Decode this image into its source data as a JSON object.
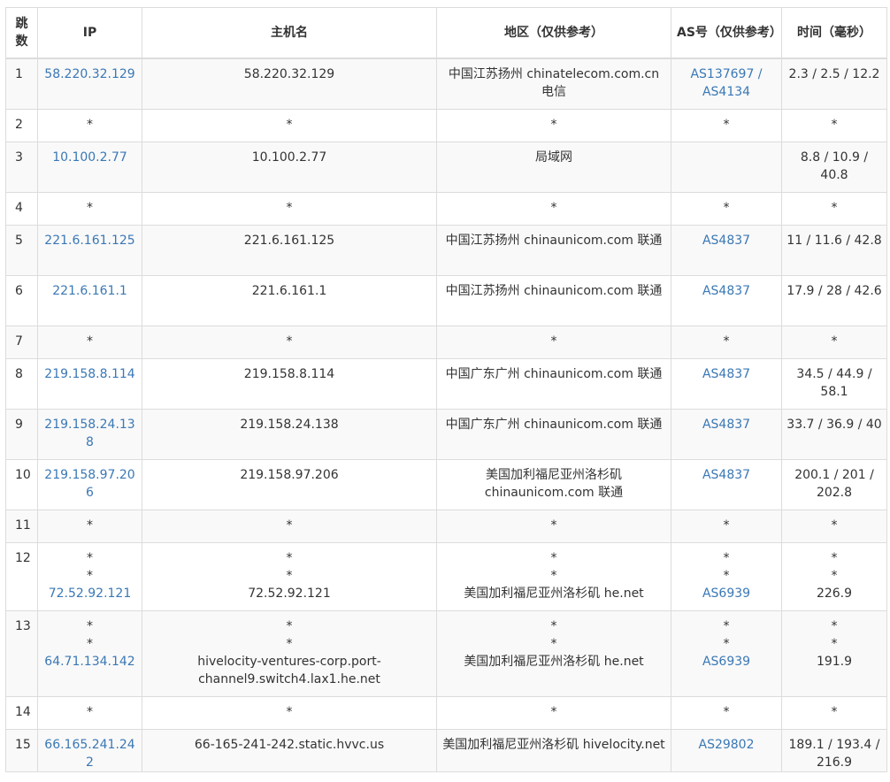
{
  "headers": [
    "跳数",
    "IP",
    "主机名",
    "地区（仅供参考）",
    "AS号（仅供参考）",
    "时间（毫秒）"
  ],
  "rows": [
    {
      "hop": "1",
      "ip": [
        "58.220.32.129"
      ],
      "host": [
        "58.220.32.129"
      ],
      "region": [
        "中国江苏扬州 chinatelecom.com.cn 电信"
      ],
      "as": [
        "AS137697 / AS4134"
      ],
      "time": [
        "2.3 / 2.5 / 12.2"
      ],
      "h": 57
    },
    {
      "hop": "2",
      "ip": [
        "*"
      ],
      "host": [
        "*"
      ],
      "region": [
        "*"
      ],
      "as": [
        "*"
      ],
      "time": [
        "*"
      ],
      "h": 37
    },
    {
      "hop": "3",
      "ip": [
        "10.100.2.77"
      ],
      "host": [
        "10.100.2.77"
      ],
      "region": [
        "局域网"
      ],
      "as": [
        ""
      ],
      "time": [
        "8.8 / 10.9 / 40.8"
      ],
      "h": 57
    },
    {
      "hop": "4",
      "ip": [
        "*"
      ],
      "host": [
        "*"
      ],
      "region": [
        "*"
      ],
      "as": [
        "*"
      ],
      "time": [
        "*"
      ],
      "h": 37
    },
    {
      "hop": "5",
      "ip": [
        "221.6.161.125"
      ],
      "host": [
        "221.6.161.125"
      ],
      "region": [
        "中国江苏扬州 chinaunicom.com 联通"
      ],
      "as": [
        "AS4837"
      ],
      "time": [
        "11 / 11.6 / 42.8"
      ],
      "h": 57
    },
    {
      "hop": "6",
      "ip": [
        "221.6.161.1"
      ],
      "host": [
        "221.6.161.1"
      ],
      "region": [
        "中国江苏扬州 chinaunicom.com 联通"
      ],
      "as": [
        "AS4837"
      ],
      "time": [
        "17.9 / 28 / 42.6"
      ],
      "h": 57
    },
    {
      "hop": "7",
      "ip": [
        "*"
      ],
      "host": [
        "*"
      ],
      "region": [
        "*"
      ],
      "as": [
        "*"
      ],
      "time": [
        "*"
      ],
      "h": 37
    },
    {
      "hop": "8",
      "ip": [
        "219.158.8.114"
      ],
      "host": [
        "219.158.8.114"
      ],
      "region": [
        "中国广东广州 chinaunicom.com 联通"
      ],
      "as": [
        "AS4837"
      ],
      "time": [
        "34.5 / 44.9 / 58.1"
      ],
      "h": 57
    },
    {
      "hop": "9",
      "ip": [
        "219.158.24.138"
      ],
      "host": [
        "219.158.24.138"
      ],
      "region": [
        "中国广东广州 chinaunicom.com 联通"
      ],
      "as": [
        "AS4837"
      ],
      "time": [
        "33.7 / 36.9 / 40"
      ],
      "h": 57
    },
    {
      "hop": "10",
      "ip": [
        "219.158.97.206"
      ],
      "host": [
        "219.158.97.206"
      ],
      "region": [
        "美国加利福尼亚州洛杉矶 chinaunicom.com 联通"
      ],
      "as": [
        "AS4837"
      ],
      "time": [
        "200.1 / 201 / 202.8"
      ],
      "h": 57
    },
    {
      "hop": "11",
      "ip": [
        "*"
      ],
      "host": [
        "*"
      ],
      "region": [
        "*"
      ],
      "as": [
        "*"
      ],
      "time": [
        "*"
      ],
      "h": 37
    },
    {
      "hop": "12",
      "ip": [
        "*",
        "*",
        "72.52.92.121"
      ],
      "host": [
        "*",
        "*",
        "72.52.92.121"
      ],
      "region": [
        "*",
        "*",
        "美国加利福尼亚州洛杉矶 he.net"
      ],
      "as": [
        "*",
        "*",
        "AS6939"
      ],
      "time": [
        "*",
        "*",
        "226.9"
      ],
      "h": 77
    },
    {
      "hop": "13",
      "ip": [
        "*",
        "*",
        "64.71.134.142"
      ],
      "host": [
        "*",
        "*",
        "hivelocity-ventures-corp.port-channel9.switch4.lax1.he.net"
      ],
      "region": [
        "*",
        "*",
        "美国加利福尼亚州洛杉矶 he.net"
      ],
      "as": [
        "*",
        "*",
        "AS6939"
      ],
      "time": [
        "*",
        "*",
        "191.9"
      ],
      "h": 97
    },
    {
      "hop": "14",
      "ip": [
        "*"
      ],
      "host": [
        "*"
      ],
      "region": [
        "*"
      ],
      "as": [
        "*"
      ],
      "time": [
        "*"
      ],
      "h": 37
    },
    {
      "hop": "15",
      "ip": [
        "66.165.241.242"
      ],
      "host": [
        "66-165-241-242.static.hvvc.us"
      ],
      "region": [
        "美国加利福尼亚州洛杉矶 hivelocity.net"
      ],
      "as": [
        "AS29802"
      ],
      "time": [
        "189.1 / 193.4 / 216.9"
      ],
      "h": 48
    }
  ]
}
